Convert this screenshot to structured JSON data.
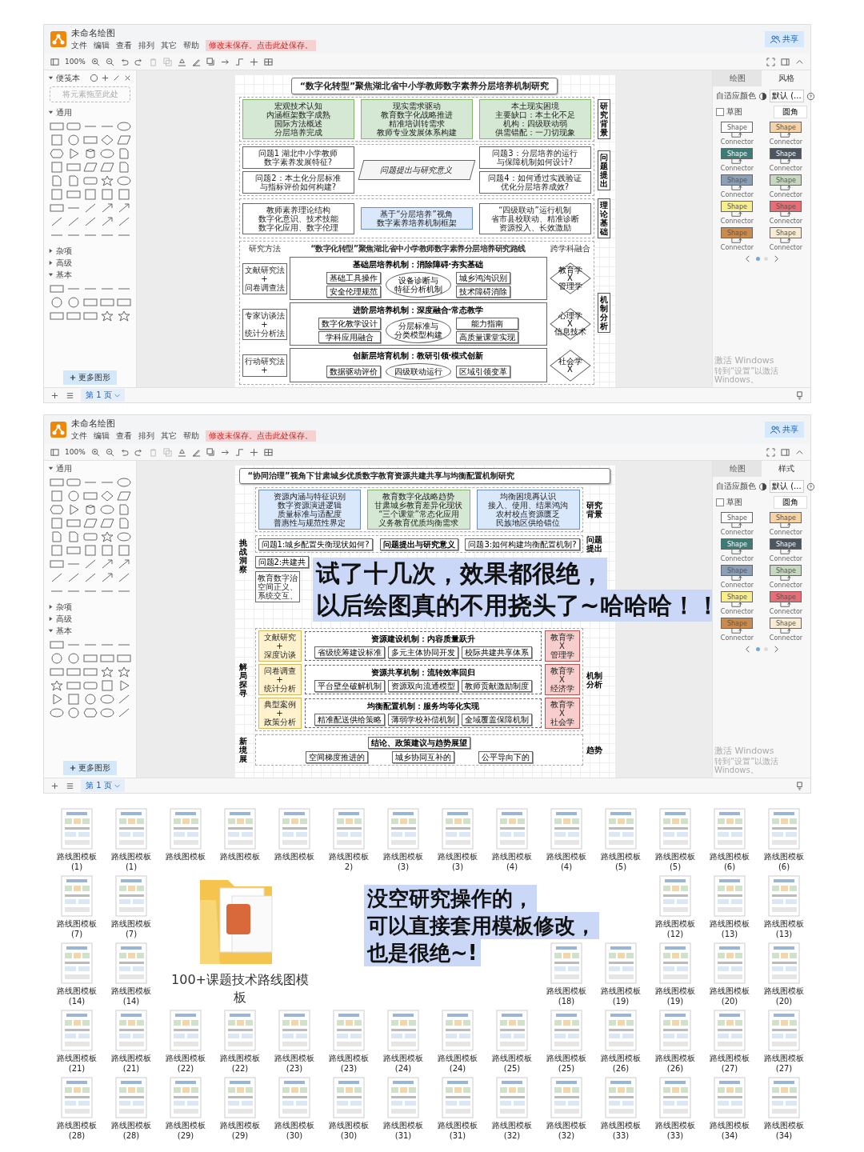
{
  "windows": [
    {
      "app": {
        "title": "未命名绘图",
        "menus": [
          "文件",
          "编辑",
          "查看",
          "排列",
          "其它",
          "帮助"
        ],
        "notice": "修改未保存。点击此处保存。",
        "share": "共享",
        "zoom": "100%"
      },
      "sidebar": {
        "sections": [
          {
            "kind": "scratchpad",
            "title": "便笺本",
            "placeholder": "将元素拖至此处",
            "expanded": true
          },
          {
            "kind": "general_shapes",
            "title": "通用",
            "expanded": true
          },
          {
            "kind": "header",
            "title": "杂项",
            "expanded": false
          },
          {
            "kind": "header",
            "title": "高级",
            "expanded": false
          },
          {
            "kind": "basic_shapes",
            "title": "基本",
            "expanded": true
          }
        ],
        "more": "更多图形"
      },
      "diagram": {
        "kind": "stacked",
        "title": "“数字化转型”聚焦湖北省中小学教师数字素养分层培养机制研究",
        "sections": [
          {
            "kind": "boxes",
            "stage": "研究背景",
            "columns": [
              [
                {
                  "kind": "green",
                  "lines": [
                    "宏观技术认知",
                    "内涵框架数字成熟",
                    "国际方法概述",
                    "分层培养完成"
                  ]
                }
              ],
              [
                {
                  "kind": "green",
                  "lines": [
                    "现实需求驱动",
                    "教育数字化战略推进",
                    "精准培训转需求",
                    "教师专业发展体系构建"
                  ]
                }
              ],
              [
                {
                  "kind": "green",
                  "lines": [
                    "本土现实困境",
                    "主要缺口：本土化不足",
                    "机构：四级联动弱",
                    "供需错配：一刀切现象"
                  ]
                }
              ]
            ]
          },
          {
            "kind": "boxes",
            "stage": "问题提出",
            "columns": [
              [
                {
                  "kind": "plain",
                  "lines": [
                    "问题1 湖北中小学教师",
                    "数字素养发展特征?"
                  ]
                },
                {
                  "kind": "plain",
                  "lines": [
                    "问题2：本土化分层标准",
                    "与指标评价如何构建?"
                  ]
                }
              ],
              [
                {
                  "kind": "parallelogram",
                  "lines": [
                    "问题提出与研究意义"
                  ]
                }
              ],
              [
                {
                  "kind": "plain",
                  "lines": [
                    "问题3：分层培养的运行",
                    "与保障机制如何设计?"
                  ]
                },
                {
                  "kind": "plain",
                  "lines": [
                    "问题4：如何通过实践验证",
                    "优化分层培养成效?"
                  ]
                }
              ]
            ]
          },
          {
            "kind": "boxes",
            "stage": "理论基础",
            "columns": [
              [
                {
                  "kind": "plain",
                  "lines": [
                    "教师素养理论结构",
                    "数字化意识、技术技能",
                    "数字化应用、数字伦理"
                  ]
                }
              ],
              [
                {
                  "kind": "blue",
                  "lines": [
                    "基于“分层培养”视角",
                    "数字素养培养机制框架"
                  ]
                }
              ],
              [
                {
                  "kind": "plain",
                  "lines": [
                    "“四级联动”运行机制",
                    "省市县校联动、精准诊断",
                    "资源投入、长效激励"
                  ]
                }
              ]
            ]
          },
          {
            "kind": "route",
            "stage": "机制分析",
            "header": [
              "研究方法",
              "“数字化转型”聚焦湖北省中小学教师数字素养分层培养研究路线",
              "跨学科融合"
            ],
            "layers": [
              {
                "title": "基础层培养机制：消除障碍·夯实基础",
                "method": [
                  "文献研究法",
                  "+",
                  "问卷调查法"
                ],
                "left": [
                  "基础工具操作",
                  "安全伦理规范"
                ],
                "hub": [
                  "设备诊断与",
                  "特征分析机制"
                ],
                "right": [
                  "城乡鸿沟识别",
                  "技术障碍消除"
                ],
                "cross": [
                  "教育学",
                  "X",
                  "管理学"
                ]
              },
              {
                "title": "进阶层培养机制：深度融合·常态教学",
                "method": [
                  "专家访谈法",
                  "+",
                  "统计分析法"
                ],
                "left": [
                  "数字化教学设计",
                  "学科应用融合"
                ],
                "hub": [
                  "分层标准与",
                  "分类模型构建"
                ],
                "right": [
                  "能力指南",
                  "高质量课堂实现"
                ],
                "cross": [
                  "心理学",
                  "X",
                  "信息技术"
                ]
              },
              {
                "title": "创新层培育机制：教研引领·模式创新",
                "method": [
                  "行动研究法",
                  "+"
                ],
                "left": [
                  "数据驱动评价"
                ],
                "hub": [
                  "四级联动运行"
                ],
                "right": [
                  "区域引领变革"
                ],
                "cross": [
                  "社会学",
                  "X"
                ]
              }
            ]
          }
        ]
      },
      "format": {
        "tabs": [
          {
            "label": "绘图",
            "selected": false
          },
          {
            "label": "风格",
            "selected": true
          }
        ],
        "adaptive": "自适应颜色",
        "theme": "默认 (...",
        "sketch": {
          "label": "草图",
          "checked": false
        },
        "rounded": "圆角",
        "styles": [
          {
            "color": "#ffffff",
            "shape": "Shape",
            "connector": "Connector"
          },
          {
            "color": "#f5d3a6",
            "shape": "Shape",
            "connector": "Connector"
          },
          {
            "color": "#3d7c76",
            "shape": "Shape",
            "connector": "Connector"
          },
          {
            "color": "#4b5660",
            "shape": "Shape",
            "connector": "Connector"
          },
          {
            "color": "#8ba0b6",
            "shape": "Shape",
            "connector": "Connector"
          },
          {
            "color": "#c6d9c0",
            "shape": "Shape",
            "connector": "Connector"
          },
          {
            "color": "#f9ee8c",
            "shape": "Shape",
            "connector": "Connector"
          },
          {
            "color": "#ea6c74",
            "shape": "Shape",
            "connector": "Connector"
          },
          {
            "color": "#cc8b4e",
            "shape": "Shape",
            "connector": "Connector"
          },
          {
            "color": "#faecd4",
            "shape": "Shape",
            "connector": "Connector"
          }
        ],
        "pages": [
          {
            "selected": true
          },
          {
            "selected": false
          }
        ],
        "watermark": {
          "title": "激活 Windows",
          "hint": "转到“设置”以激活 Windows。"
        }
      },
      "footer": {
        "page": "第 1 页"
      }
    },
    {
      "app": {
        "title": "未命名绘图",
        "menus": [
          "文件",
          "编辑",
          "查看",
          "排列",
          "其它",
          "帮助"
        ],
        "notice": "修改未保存。点击此处保存。",
        "share": "共享",
        "zoom": "100%"
      },
      "sidebar": {
        "sections": [
          {
            "kind": "general_shapes",
            "title": "通用",
            "expanded": true
          },
          {
            "kind": "header",
            "title": "杂项",
            "expanded": false
          },
          {
            "kind": "header",
            "title": "高级",
            "expanded": false
          },
          {
            "kind": "basic_shapes_more",
            "title": "基本",
            "expanded": true
          }
        ],
        "more": "更多图形"
      },
      "diagram": {
        "kind": "framed",
        "title": "“协同治理”视角下甘肃城乡优质数字教育资源共建共享与均衡配置机制研究",
        "left_labels": [
          "挑战洞察",
          "解局探寻",
          "新境展"
        ],
        "background": {
          "stage": "研究背景",
          "boxes": [
            {
              "kind": "blue",
              "lines": [
                "资源内涵与特征识别",
                "数字资源演进逻辑",
                "质量标准与适配度",
                "普惠性与规范性界定"
              ]
            },
            {
              "kind": "green",
              "lines": [
                "教育数字化战略趋势",
                "甘肃城乡教育差异化现状",
                "“三个课堂”常态化应用",
                "义务教育优质均衡需求"
              ]
            },
            {
              "kind": "blue",
              "lines": [
                "均衡困境再认识",
                "接入、使用、结果鸿沟",
                "农村校点资源匮乏",
                "民族地区供给错位"
              ]
            }
          ]
        },
        "questions": {
          "stage": "问题提出",
          "left": "问题1:城乡配置失衡现状如何?",
          "center": "问题提出与研究意义",
          "right": "问题3:如何构建均衡配置机制?"
        },
        "covered": {
          "question": "问题2:共建共",
          "theory": [
            "教育数字治",
            "空间正义、",
            "系统交互、"
          ]
        },
        "caption": [
          "试了十几次，效果都很绝，",
          "以后绘图真的不用挠头了~哈哈哈！！"
        ],
        "mechanisms": {
          "stage": "机制分析",
          "rows": [
            {
              "method": [
                "文献研究",
                "+",
                "深度访谈"
              ],
              "title": "资源建设机制：内容质量跃升",
              "items": [
                "省级统筹建设标准",
                "多元主体协同开发",
                "校际共建共享体系"
              ],
              "cross": [
                "教育学",
                "X",
                "管理学"
              ]
            },
            {
              "method": [
                "问卷调查",
                "+",
                "统计分析"
              ],
              "title": "资源共享机制：流转效率回归",
              "items": [
                "平台壁垒破解机制",
                "资源双向流通模型",
                "教师贡献激励制度"
              ],
              "cross": [
                "教育学",
                "X",
                "经济学"
              ]
            },
            {
              "method": [
                "典型案例",
                "+",
                "政策分析"
              ],
              "title": "均衡配置机制：服务均等化实现",
              "items": [
                "精准配送供给策略",
                "薄弱学校补偿机制",
                "全域覆盖保障机制"
              ],
              "cross": [
                "教育学",
                "X",
                "社会学"
              ]
            }
          ]
        },
        "trend": {
          "stage": "趋势",
          "conclusion": "结论、政策建议与趋势展望",
          "items": [
            "空间梯度推进的",
            "城乡协同互补的",
            "公平导向下的"
          ]
        }
      },
      "format": {
        "tabs": [
          {
            "label": "绘图",
            "selected": false
          },
          {
            "label": "样式",
            "selected": true
          }
        ],
        "adaptive": "自适应颜色",
        "theme": "默认 (...",
        "sketch": {
          "label": "草图",
          "checked": false
        },
        "rounded": "圆角",
        "styles": [
          {
            "color": "#ffffff",
            "shape": "Shape",
            "connector": "Connector"
          },
          {
            "color": "#f5d3a6",
            "shape": "Shape",
            "connector": "Connector"
          },
          {
            "color": "#3d7c76",
            "shape": "Shape",
            "connector": "Connector"
          },
          {
            "color": "#4b5660",
            "shape": "Shape",
            "connector": "Connector"
          },
          {
            "color": "#8ba0b6",
            "shape": "Shape",
            "connector": "Connector"
          },
          {
            "color": "#c6d9c0",
            "shape": "Shape",
            "connector": "Connector"
          },
          {
            "color": "#f9ee8c",
            "shape": "Shape",
            "connector": "Connector"
          },
          {
            "color": "#ea6c74",
            "shape": "Shape",
            "connector": "Connector"
          },
          {
            "color": "#cc8b4e",
            "shape": "Shape",
            "connector": "Connector"
          },
          {
            "color": "#faecd4",
            "shape": "Shape",
            "connector": "Connector"
          }
        ],
        "pages": [
          {
            "selected": true
          },
          {
            "selected": false
          }
        ],
        "watermark": {
          "title": "激活 Windows",
          "hint": "转到“设置”以激活 Windows。"
        }
      },
      "footer": {
        "page": "第 1 页"
      }
    }
  ],
  "files": {
    "folder": "100+课题技术路线图模板",
    "caption": [
      "没空研究操作的，",
      "可以直接套用模板修改，",
      "也是很绝~!"
    ],
    "items": [
      {
        "kind": "thumb",
        "name": "路线图模板",
        "num": "(1)"
      },
      {
        "kind": "thumb",
        "name": "路线图模板",
        "num": "(1)"
      },
      {
        "kind": "thumb",
        "name": "路线图模板"
      },
      {
        "kind": "thumb",
        "name": "路线图模板"
      },
      {
        "kind": "thumb",
        "name": "路线图模板"
      },
      {
        "kind": "thumb",
        "name": "路线图模板",
        "num": "2)"
      },
      {
        "kind": "thumb",
        "name": "路线图模板",
        "num": "(3)"
      },
      {
        "kind": "thumb",
        "name": "路线图模板",
        "num": "(3)"
      },
      {
        "kind": "thumb",
        "name": "路线图模板",
        "num": "(4)"
      },
      {
        "kind": "thumb",
        "name": "路线图模板",
        "num": "(4)"
      },
      {
        "kind": "thumb",
        "name": "路线图模板",
        "num": "(5)"
      },
      {
        "kind": "thumb",
        "name": "路线图模板",
        "num": "(5)"
      },
      {
        "kind": "thumb",
        "name": "路线图模板",
        "num": "(6)"
      },
      {
        "kind": "thumb",
        "name": "路线图模板",
        "num": "(6)"
      },
      {
        "kind": "thumb",
        "name": "路线图模板",
        "num": "(7)"
      },
      {
        "kind": "thumb",
        "name": "路线图模板",
        "num": "(7)"
      },
      {
        "kind": "folder"
      },
      {
        "kind": "gap"
      },
      {
        "kind": "gap"
      },
      {
        "kind": "gap"
      },
      {
        "kind": "gap"
      },
      {
        "kind": "gap"
      },
      {
        "kind": "gap"
      },
      {
        "kind": "thumb",
        "name": "路线图模板",
        "num": "(12)"
      },
      {
        "kind": "thumb",
        "name": "路线图模板",
        "num": "(13)"
      },
      {
        "kind": "thumb",
        "name": "路线图模板",
        "num": "(13)"
      },
      {
        "kind": "thumb",
        "name": "路线图模板",
        "num": "(14)"
      },
      {
        "kind": "thumb",
        "name": "路线图模板",
        "num": "(14)"
      },
      {
        "kind": "gap"
      },
      {
        "kind": "gap"
      },
      {
        "kind": "gap"
      },
      {
        "kind": "gap"
      },
      {
        "kind": "thumb",
        "name": "路线图模板",
        "num": "(18)"
      },
      {
        "kind": "thumb",
        "name": "路线图模板",
        "num": "(19)"
      },
      {
        "kind": "thumb",
        "name": "路线图模板",
        "num": "(19)"
      },
      {
        "kind": "thumb",
        "name": "路线图模板",
        "num": "(20)"
      },
      {
        "kind": "thumb",
        "name": "路线图模板",
        "num": "(20)"
      },
      {
        "kind": "thumb",
        "name": "路线图模板",
        "num": "(21)"
      },
      {
        "kind": "thumb",
        "name": "路线图模板",
        "num": "(21)"
      },
      {
        "kind": "thumb",
        "name": "路线图模板",
        "num": "(22)"
      },
      {
        "kind": "thumb",
        "name": "路线图模板",
        "num": "(22)"
      },
      {
        "kind": "thumb",
        "name": "路线图模板",
        "num": "(23)"
      },
      {
        "kind": "thumb",
        "name": "路线图模板",
        "num": "(23)"
      },
      {
        "kind": "thumb",
        "name": "路线图模板",
        "num": "(24)"
      },
      {
        "kind": "thumb",
        "name": "路线图模板",
        "num": "(24)"
      },
      {
        "kind": "thumb",
        "name": "路线图模板",
        "num": "(25)"
      },
      {
        "kind": "thumb",
        "name": "路线图模板",
        "num": "(25)"
      },
      {
        "kind": "thumb",
        "name": "路线图模板",
        "num": "(26)"
      },
      {
        "kind": "thumb",
        "name": "路线图模板",
        "num": "(26)"
      },
      {
        "kind": "thumb",
        "name": "路线图模板",
        "num": "(27)"
      },
      {
        "kind": "thumb",
        "name": "路线图模板",
        "num": "(27)"
      },
      {
        "kind": "thumb",
        "name": "路线图模板",
        "num": "(28)"
      },
      {
        "kind": "thumb",
        "name": "路线图模板",
        "num": "(28)"
      },
      {
        "kind": "thumb",
        "name": "路线图模板",
        "num": "(29)"
      },
      {
        "kind": "thumb",
        "name": "路线图模板",
        "num": "(29)"
      },
      {
        "kind": "thumb",
        "name": "路线图模板",
        "num": "(30)"
      },
      {
        "kind": "thumb",
        "name": "路线图模板",
        "num": "(30)"
      },
      {
        "kind": "thumb",
        "name": "路线图模板",
        "num": "(31)"
      },
      {
        "kind": "thumb",
        "name": "路线图模板",
        "num": "(31)"
      },
      {
        "kind": "thumb",
        "name": "路线图模板",
        "num": "(32)"
      },
      {
        "kind": "thumb",
        "name": "路线图模板",
        "num": "(32)"
      },
      {
        "kind": "thumb",
        "name": "路线图模板",
        "num": "(33)"
      },
      {
        "kind": "thumb",
        "name": "路线图模板",
        "num": "(33)"
      },
      {
        "kind": "thumb",
        "name": "路线图模板",
        "num": "(34)"
      },
      {
        "kind": "thumb",
        "name": "路线图模板",
        "num": "(34)"
      }
    ]
  }
}
